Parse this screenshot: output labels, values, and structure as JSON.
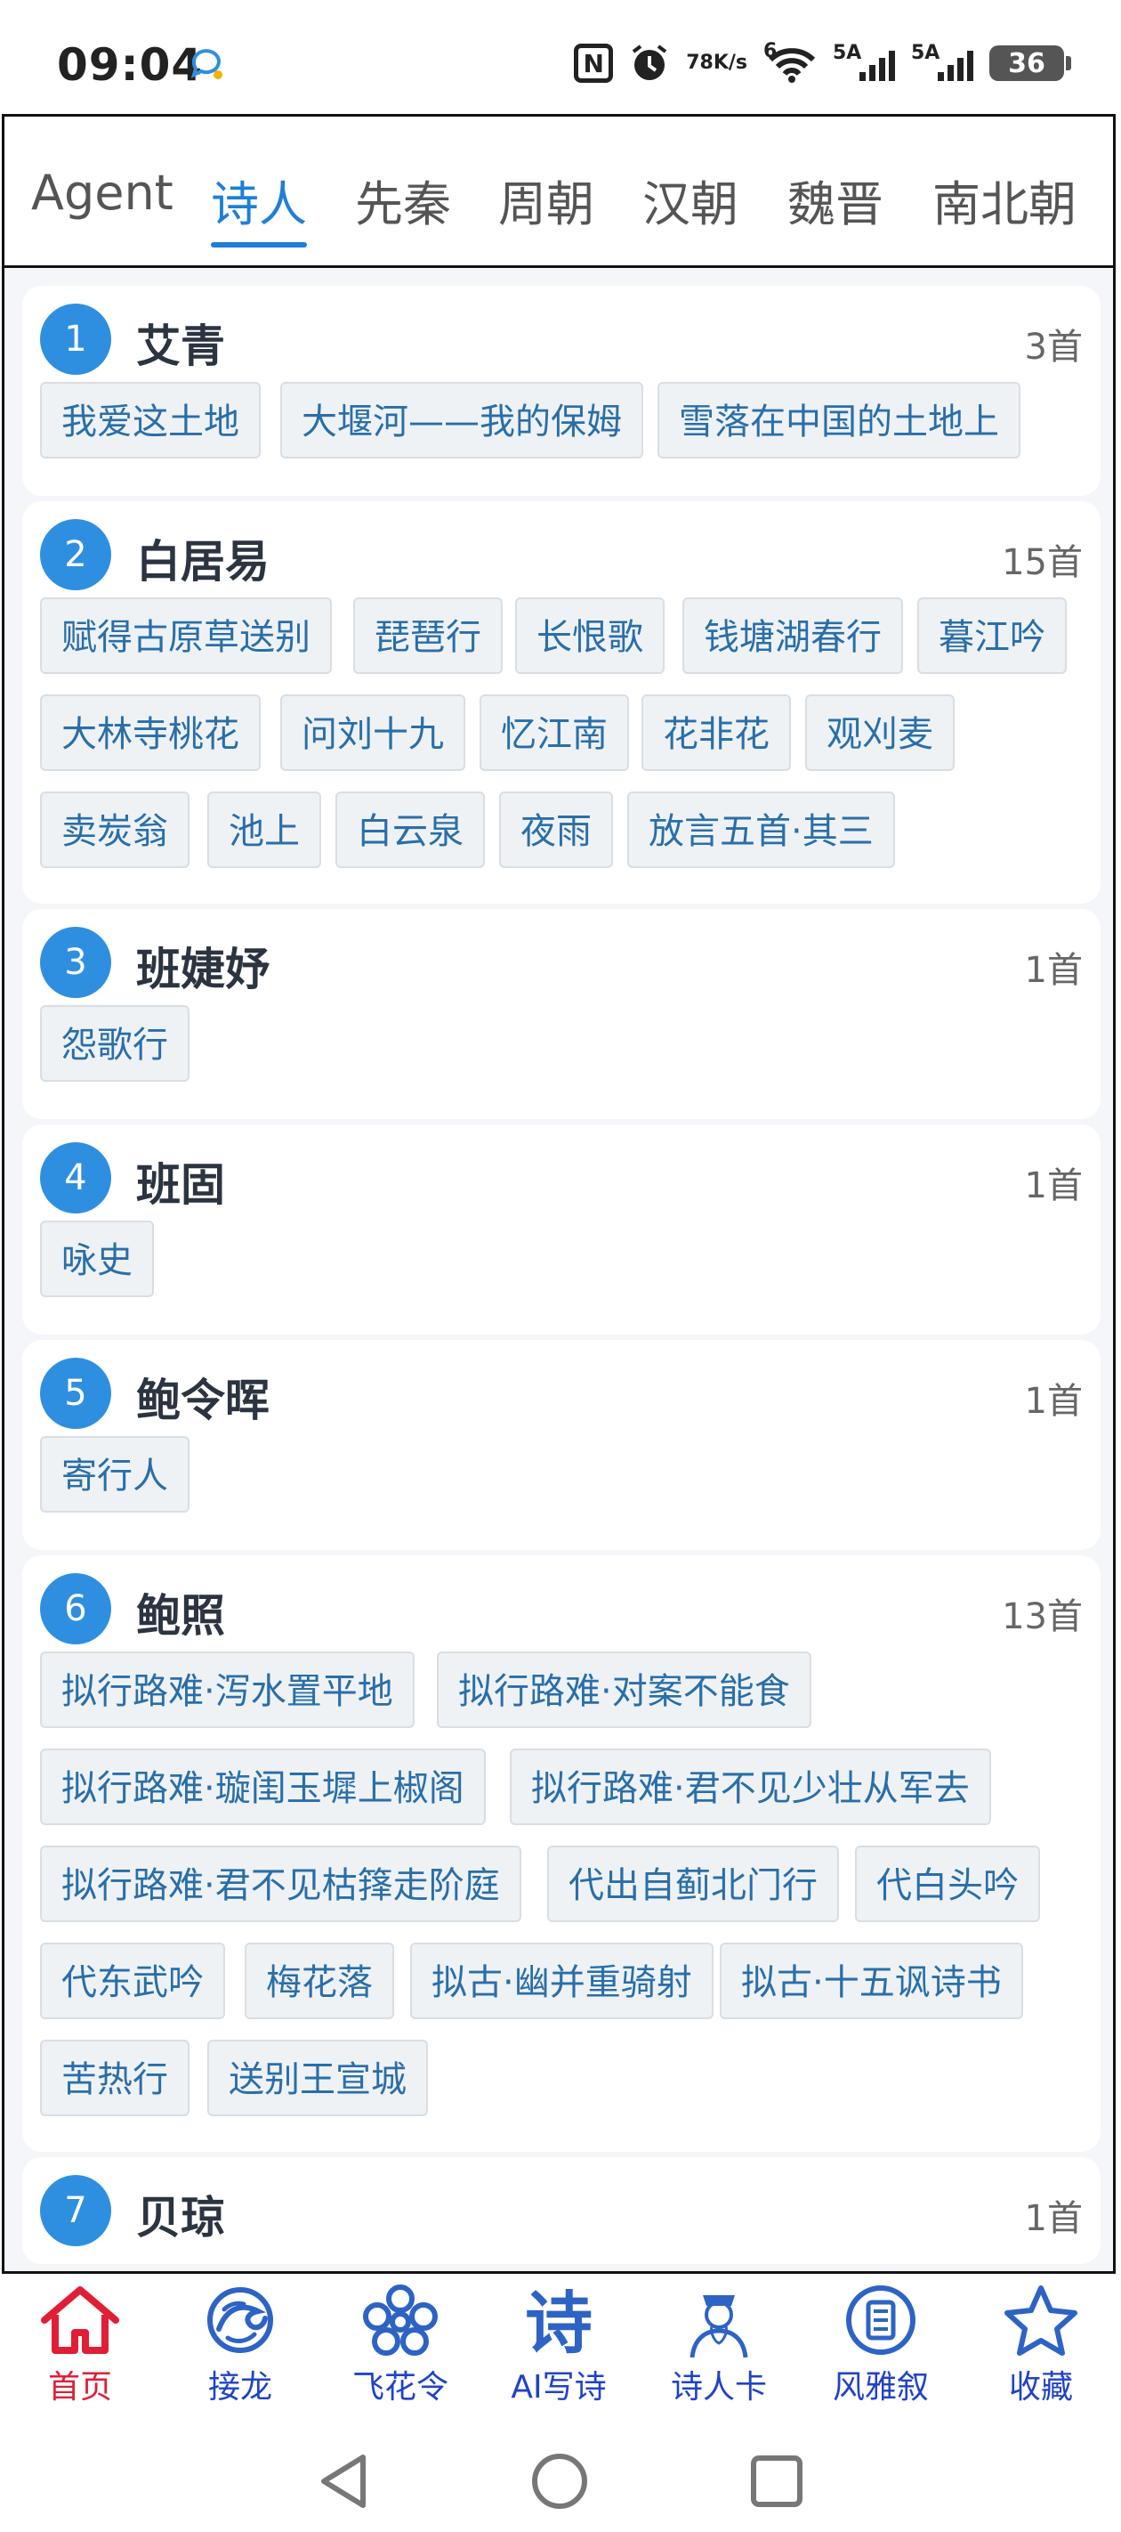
{
  "status_bar": {
    "time": "09:04",
    "network_speed_top": "78",
    "network_speed_bottom": "K/s",
    "wifi_label": "6",
    "sim1_label": "5A",
    "sim2_label": "5A",
    "battery_level": "36"
  },
  "tabs": [
    {
      "label": "Agent",
      "active": false
    },
    {
      "label": "诗人",
      "active": true
    },
    {
      "label": "先秦",
      "active": false
    },
    {
      "label": "周朝",
      "active": false
    },
    {
      "label": "汉朝",
      "active": false
    },
    {
      "label": "魏晋",
      "active": false
    },
    {
      "label": "南北朝",
      "active": false
    }
  ],
  "poets": [
    {
      "rank": "1",
      "name": "艾青",
      "count": "3首",
      "poems": [
        "我爱这土地",
        "大堰河——我的保姆",
        "雪落在中国的土地上"
      ]
    },
    {
      "rank": "2",
      "name": "白居易",
      "count": "15首",
      "poems": [
        "赋得古原草送别",
        "琵琶行",
        "长恨歌",
        "钱塘湖春行",
        "暮江吟",
        "大林寺桃花",
        "问刘十九",
        "忆江南",
        "花非花",
        "观刈麦",
        "卖炭翁",
        "池上",
        "白云泉",
        "夜雨",
        "放言五首·其三"
      ]
    },
    {
      "rank": "3",
      "name": "班婕妤",
      "count": "1首",
      "poems": [
        "怨歌行"
      ]
    },
    {
      "rank": "4",
      "name": "班固",
      "count": "1首",
      "poems": [
        "咏史"
      ]
    },
    {
      "rank": "5",
      "name": "鲍令晖",
      "count": "1首",
      "poems": [
        "寄行人"
      ]
    },
    {
      "rank": "6",
      "name": "鲍照",
      "count": "13首",
      "poems": [
        "拟行路难·泻水置平地",
        "拟行路难·对案不能食",
        "拟行路难·璇闺玉墀上椒阁",
        "拟行路难·君不见少壮从军去",
        "拟行路难·君不见枯箨走阶庭",
        "代出自蓟北门行",
        "代白头吟",
        "代东武吟",
        "梅花落",
        "拟古·幽并重骑射",
        "拟古·十五讽诗书",
        "苦热行",
        "送别王宣城"
      ]
    },
    {
      "rank": "7",
      "name": "贝琼",
      "count": "1首",
      "poems": []
    }
  ],
  "bottom_nav": [
    {
      "label": "首页",
      "icon": "home-icon",
      "active": true
    },
    {
      "label": "接龙",
      "icon": "dragon-icon",
      "active": false
    },
    {
      "label": "飞花令",
      "icon": "flower-icon",
      "active": false
    },
    {
      "label": "AI写诗",
      "icon": "poem-character-icon",
      "active": false
    },
    {
      "label": "诗人卡",
      "icon": "poet-portrait-icon",
      "active": false
    },
    {
      "label": "风雅叙",
      "icon": "scroll-icon",
      "active": false
    },
    {
      "label": "收藏",
      "icon": "star-icon",
      "active": false
    }
  ],
  "colors": {
    "accent": "#1e7fd6",
    "badge": "#2e8fe0",
    "chip_text": "#2a6ea8",
    "nav_active": "#e01e36",
    "nav_inactive": "#2042c8"
  }
}
